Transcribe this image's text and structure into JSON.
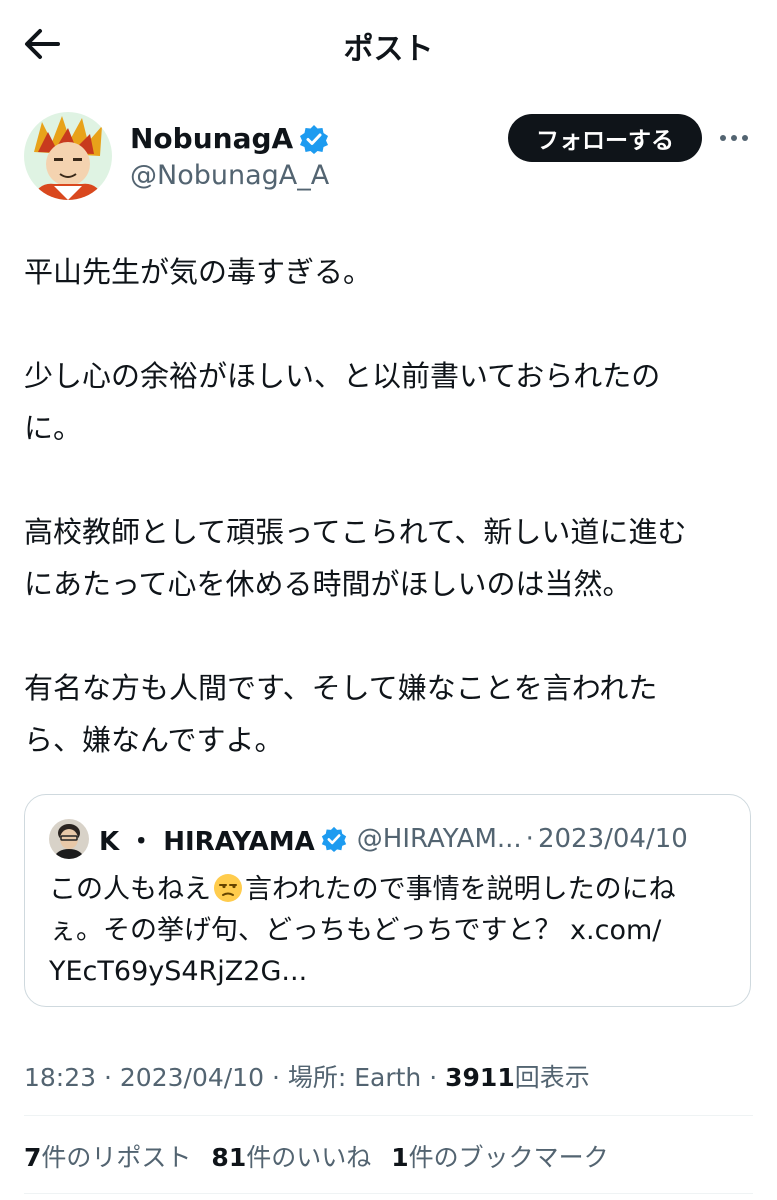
{
  "header": {
    "title": "ポスト",
    "back_icon": "arrow-left-icon"
  },
  "author": {
    "display_name": "NobunagA",
    "handle": "@NobunagA_A",
    "verified_color": "#1d9bf0",
    "follow_label": "フォローする",
    "more_icon": "more-horizontal-icon"
  },
  "post": {
    "paragraphs": [
      [
        "平山先生が気の毒すぎる。"
      ],
      [
        "少し心の余裕がほしい、と以前書いておられたの",
        "に。"
      ],
      [
        "高校教師として頑張ってこられて、新しい道に進む",
        "にあたって心を休める時間がほしいのは当然。"
      ],
      [
        "有名な方も人間です、そして嫌なことを言われた",
        "ら、嫌なんですよ。"
      ]
    ]
  },
  "quote": {
    "name": "K ・ HIRAYAMA",
    "handle": "@HIRAYAM...",
    "separator": "·",
    "date": "2023/04/10",
    "text_line1_a": "この人もねえ",
    "emoji": "unamused-face",
    "text_line1_b": "言われたので事情を説明したのにね",
    "text_line2": "ぇ。その挙げ句、どっちもどっちですと？ x.com/",
    "text_line3": "YEcT69yS4RjZ2G..."
  },
  "meta": {
    "time": "18:23",
    "date": "2023/04/10",
    "location_label": "場所: Earth",
    "views_count": "3911",
    "views_label": "回表示",
    "separator": "·"
  },
  "stats": [
    {
      "count": "7",
      "label": "件のリポスト"
    },
    {
      "count": "81",
      "label": "件のいいね"
    },
    {
      "count": "1",
      "label": "件のブックマーク"
    }
  ],
  "colors": {
    "text": "#0f1419",
    "secondary": "#536471",
    "border": "#cfd9de",
    "accent": "#1d9bf0"
  }
}
